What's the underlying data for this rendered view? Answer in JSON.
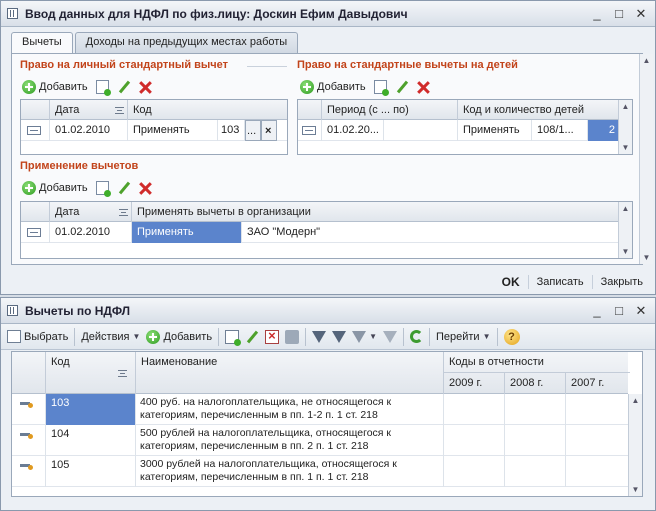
{
  "window1": {
    "title": "Ввод данных для НДФЛ по физ.лицу: Доскин Ефим Давыдович",
    "controls": {
      "minimize": "_",
      "maximize": "□",
      "close": "✕"
    },
    "tabs": [
      {
        "label": "Вычеты"
      },
      {
        "label": "Доходы на предыдущих местах работы"
      }
    ],
    "personal": {
      "title": "Право на личный стандартный вычет",
      "add_label": "Добавить",
      "columns": [
        "Дата",
        "Код"
      ],
      "rows": [
        {
          "date": "01.02.2010",
          "code_action": "Применять",
          "code_value": "103",
          "ellipsis": "...",
          "clear": "×"
        }
      ]
    },
    "children": {
      "title": "Право на стандартные вычеты на детей",
      "add_label": "Добавить",
      "columns": [
        "Период (с ... по)",
        "Код и количество детей"
      ],
      "rows": [
        {
          "period": "01.02.20...",
          "action": "Применять",
          "code": "108/1...",
          "count": "2"
        }
      ]
    },
    "apply": {
      "title": "Применение вычетов",
      "add_label": "Добавить",
      "columns": [
        "Дата",
        "Применять вычеты в организации"
      ],
      "rows": [
        {
          "date": "01.02.2010",
          "action": "Применять",
          "org": "ЗАО \"Модерн\""
        }
      ]
    },
    "footer": {
      "ok": "OK",
      "save": "Записать",
      "close": "Закрыть"
    }
  },
  "window2": {
    "title": "Вычеты по НДФЛ",
    "controls": {
      "minimize": "_",
      "maximize": "□",
      "close": "✕"
    },
    "toolbar": {
      "select": "Выбрать",
      "actions": "Действия",
      "add": "Добавить",
      "goto": "Перейти",
      "help": "?"
    },
    "table": {
      "col_code": "Код",
      "col_name": "Наименование",
      "col_report": "Коды в отчетности",
      "years": [
        "2009 г.",
        "2008 г.",
        "2007 г."
      ],
      "rows": [
        {
          "code": "103",
          "name": "400 руб. на налогоплательщика, не относящегося к категориям, перечисленным в пп. 1-2 п. 1 ст. 218"
        },
        {
          "code": "104",
          "name": "500 рублей на налогоплательщика, относящегося к категориям, перечисленным в пп. 2 п. 1 ст. 218"
        },
        {
          "code": "105",
          "name": "3000 рублей на налогоплательщика, относящегося к категориям, перечисленным в пп. 1 п. 1 ст. 218"
        }
      ]
    }
  },
  "colors": {
    "section_title": "#c2441b",
    "selection": "#5b84cc"
  }
}
